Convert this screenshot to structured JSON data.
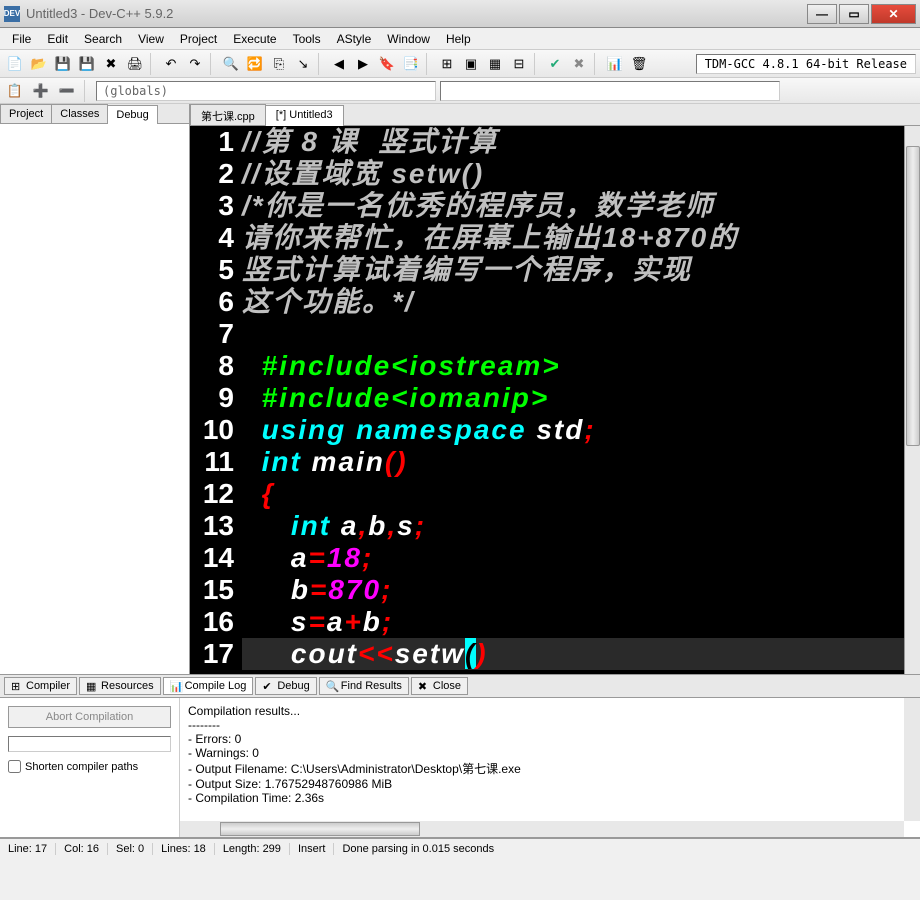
{
  "window": {
    "title": "Untitled3 - Dev-C++ 5.9.2",
    "app_icon_text": "DEV"
  },
  "menu": [
    "File",
    "Edit",
    "Search",
    "View",
    "Project",
    "Execute",
    "Tools",
    "AStyle",
    "Window",
    "Help"
  ],
  "toolbar": {
    "compiler_label": "TDM-GCC 4.8.1 64-bit Release"
  },
  "globals_dropdown": "(globals)",
  "side_tabs": [
    "Project",
    "Classes",
    "Debug"
  ],
  "side_active": "Debug",
  "file_tabs": [
    "第七课.cpp",
    "[*] Untitled3"
  ],
  "file_active": "[*] Untitled3",
  "code": {
    "lines": [
      {
        "n": "1",
        "seg": [
          {
            "t": "//第 8 课  竖式计算",
            "c": "c-comment"
          }
        ]
      },
      {
        "n": "2",
        "seg": [
          {
            "t": "//设置域宽 setw()",
            "c": "c-comment"
          }
        ]
      },
      {
        "n": "3",
        "seg": [
          {
            "t": "/*你是一名优秀的程序员，数学老师",
            "c": "c-comment"
          }
        ]
      },
      {
        "n": "4",
        "seg": [
          {
            "t": "请你来帮忙，在屏幕上输出18+870的",
            "c": "c-comment"
          }
        ]
      },
      {
        "n": "5",
        "seg": [
          {
            "t": "竖式计算试着编写一个程序，实现",
            "c": "c-comment"
          }
        ]
      },
      {
        "n": "6",
        "seg": [
          {
            "t": "这个功能。*/",
            "c": "c-comment"
          }
        ]
      },
      {
        "n": "7",
        "seg": []
      },
      {
        "n": "8",
        "seg": [
          {
            "t": "  ",
            "c": ""
          },
          {
            "t": "#include<iostream>",
            "c": "c-prep"
          }
        ]
      },
      {
        "n": "9",
        "seg": [
          {
            "t": "  ",
            "c": ""
          },
          {
            "t": "#include<iomanip>",
            "c": "c-prep"
          }
        ]
      },
      {
        "n": "10",
        "seg": [
          {
            "t": "  ",
            "c": ""
          },
          {
            "t": "using namespace",
            "c": "c-kw"
          },
          {
            "t": " std",
            "c": "c-id"
          },
          {
            "t": ";",
            "c": "c-op"
          }
        ]
      },
      {
        "n": "11",
        "seg": [
          {
            "t": "  ",
            "c": ""
          },
          {
            "t": "int",
            "c": "c-kw"
          },
          {
            "t": " main",
            "c": "c-id"
          },
          {
            "t": "()",
            "c": "c-br"
          }
        ]
      },
      {
        "n": "12",
        "seg": [
          {
            "t": "  ",
            "c": ""
          },
          {
            "t": "{",
            "c": "c-br"
          }
        ]
      },
      {
        "n": "13",
        "seg": [
          {
            "t": "     ",
            "c": ""
          },
          {
            "t": "int",
            "c": "c-kw"
          },
          {
            "t": " a",
            "c": "c-id"
          },
          {
            "t": ",",
            "c": "c-op"
          },
          {
            "t": "b",
            "c": "c-id"
          },
          {
            "t": ",",
            "c": "c-op"
          },
          {
            "t": "s",
            "c": "c-id"
          },
          {
            "t": ";",
            "c": "c-op"
          }
        ]
      },
      {
        "n": "14",
        "seg": [
          {
            "t": "     a",
            "c": "c-id"
          },
          {
            "t": "=",
            "c": "c-op"
          },
          {
            "t": "18",
            "c": "c-num"
          },
          {
            "t": ";",
            "c": "c-op"
          }
        ]
      },
      {
        "n": "15",
        "seg": [
          {
            "t": "     b",
            "c": "c-id"
          },
          {
            "t": "=",
            "c": "c-op"
          },
          {
            "t": "870",
            "c": "c-num"
          },
          {
            "t": ";",
            "c": "c-op"
          }
        ]
      },
      {
        "n": "16",
        "seg": [
          {
            "t": "     s",
            "c": "c-id"
          },
          {
            "t": "=",
            "c": "c-op"
          },
          {
            "t": "a",
            "c": "c-id"
          },
          {
            "t": "+",
            "c": "c-op"
          },
          {
            "t": "b",
            "c": "c-id"
          },
          {
            "t": ";",
            "c": "c-op"
          }
        ]
      },
      {
        "n": "17",
        "hl": true,
        "seg": [
          {
            "t": "     cout",
            "c": "c-id"
          },
          {
            "t": "<<",
            "c": "c-op"
          },
          {
            "t": "setw",
            "c": "c-id"
          },
          {
            "t": "(",
            "c": "c-caret"
          },
          {
            "t": ")",
            "c": "c-br"
          }
        ]
      }
    ]
  },
  "bottom_tabs": [
    {
      "icon": "⊞",
      "label": "Compiler"
    },
    {
      "icon": "▦",
      "label": "Resources"
    },
    {
      "icon": "📊",
      "label": "Compile Log",
      "active": true
    },
    {
      "icon": "✔",
      "label": "Debug"
    },
    {
      "icon": "🔍",
      "label": "Find Results"
    },
    {
      "icon": "✖",
      "label": "Close"
    }
  ],
  "output": {
    "abort_label": "Abort Compilation",
    "shorten_label": "Shorten compiler paths",
    "lines": [
      "Compilation results...",
      "--------",
      "- Errors: 0",
      "- Warnings: 0",
      "- Output Filename: C:\\Users\\Administrator\\Desktop\\第七课.exe",
      "- Output Size: 1.76752948760986 MiB",
      "- Compilation Time: 2.36s"
    ]
  },
  "status": {
    "line": "Line:   17",
    "col": "Col:   16",
    "sel": "Sel:   0",
    "lines": "Lines:   18",
    "length": "Length:   299",
    "mode": "Insert",
    "msg": "Done parsing in 0.015 seconds"
  }
}
